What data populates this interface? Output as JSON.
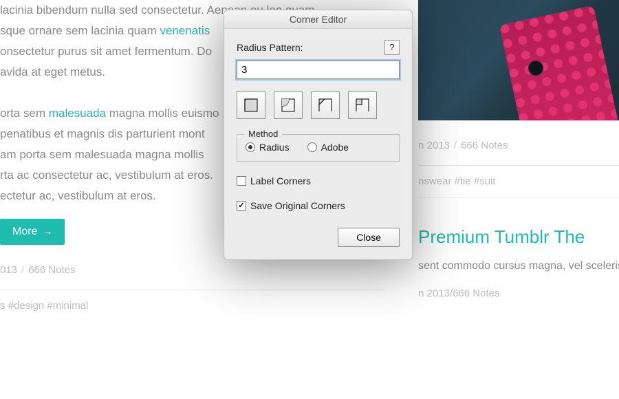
{
  "bg": {
    "paragraph1_parts": [
      "lacinia bibendum nulla sed consectetur. Aenean eu leo quam. ",
      "sque ornare sem lacinia quam ",
      "venenatis",
      " ",
      "onsectetur purus sit amet fermentum. Do",
      "avida at eget metus."
    ],
    "paragraph2_parts": [
      "orta sem ",
      "malesuada",
      " magna mollis euismo",
      " penatibus et magnis dis parturient mont",
      "am porta sem malesuada magna mollis ",
      "rta ac consectetur ac, vestibulum at eros. ",
      "ectetur ac, vestibulum at eros."
    ],
    "more_label": "More",
    "meta_date": "013",
    "meta_notes": "666 Notes",
    "tags_left": "s   #design   #minimal",
    "right_meta_date": "n 2013",
    "right_meta_notes": "666 Notes",
    "right_tags": "nswear   #tie   #suit",
    "right_title": "Premium Tumblr The",
    "right_sub": "sent commodo cursus magna, vel scelerisq",
    "right_meta2_date": "n 2013",
    "right_meta2_notes": "666 Notes"
  },
  "dialog": {
    "title": "Corner Editor",
    "radius_label": "Radius Pattern:",
    "help": "?",
    "pattern_value": "3",
    "method_legend": "Method",
    "radio_radius": "Radius",
    "radio_adobe": "Adobe",
    "method_selected": "radius",
    "label_corners": "Label Corners",
    "label_corners_checked": false,
    "save_original": "Save Original Corners",
    "save_original_checked": true,
    "close": "Close"
  }
}
